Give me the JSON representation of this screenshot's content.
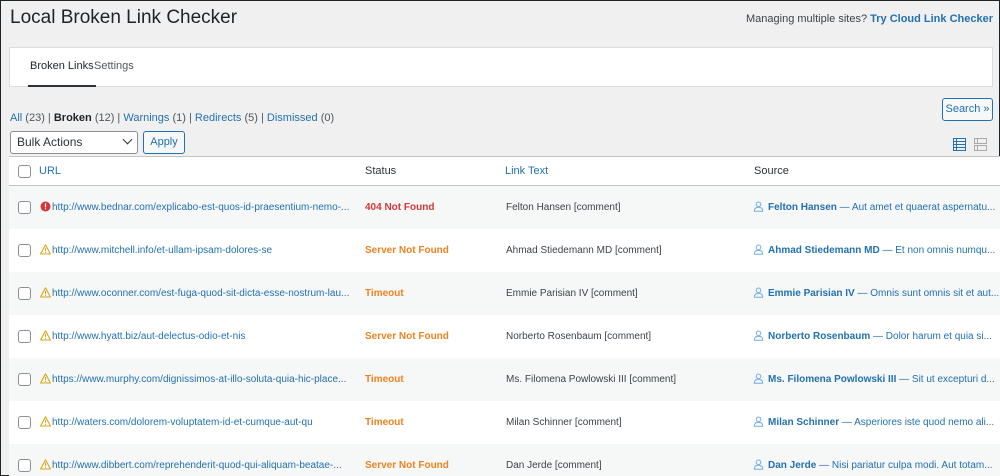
{
  "app": {
    "title": "Local Broken Link Checker",
    "promo_text": "Managing multiple sites? ",
    "promo_link": "Try Cloud Link Checker"
  },
  "tabs": [
    {
      "label": "Broken Links",
      "active": true
    },
    {
      "label": "Settings",
      "active": false
    }
  ],
  "filters": [
    {
      "label": "All",
      "count": "(23)",
      "current": false
    },
    {
      "label": "Broken",
      "count": "(12)",
      "current": true
    },
    {
      "label": "Warnings",
      "count": "(1)",
      "current": false
    },
    {
      "label": "Redirects",
      "count": "(5)",
      "current": false
    },
    {
      "label": "Dismissed",
      "count": "(0)",
      "current": false
    }
  ],
  "search_button": "Search »",
  "bulk": {
    "selected": "Bulk Actions",
    "apply_label": "Apply"
  },
  "columns": {
    "url": "URL",
    "status": "Status",
    "link_text": "Link Text",
    "source": "Source"
  },
  "colors": {
    "accent": "#2271b1",
    "error": "#d63638",
    "warning": "#f0821e",
    "warning_icon": "#dba617"
  },
  "rows": [
    {
      "icon": "error-icon",
      "url": "http://www.bednar.com/explicabo-est-quos-id-praesentium-nemo-...",
      "status": "404 Not Found",
      "status_type": "error",
      "link_text": "Felton Hansen [comment]",
      "source_author": "Felton Hansen",
      "source_excerpt": " — Aut amet et quaerat aspernatu..."
    },
    {
      "icon": "warning-icon",
      "url": "http://www.mitchell.info/et-ullam-ipsam-dolores-se",
      "status": "Server Not Found",
      "status_type": "warning",
      "link_text": "Ahmad Stiedemann MD [comment]",
      "source_author": "Ahmad Stiedemann MD",
      "source_excerpt": " — Et non omnis numqu..."
    },
    {
      "icon": "warning-icon",
      "url": "http://www.oconner.com/est-fuga-quod-sit-dicta-esse-nostrum-lau...",
      "status": "Timeout",
      "status_type": "warning",
      "link_text": "Emmie Parisian IV [comment]",
      "source_author": "Emmie Parisian IV",
      "source_excerpt": " — Omnis sunt omnis sit et aut..."
    },
    {
      "icon": "warning-icon",
      "url": "http://www.hyatt.biz/aut-delectus-odio-et-nis",
      "status": "Server Not Found",
      "status_type": "warning",
      "link_text": "Norberto Rosenbaum [comment]",
      "source_author": "Norberto Rosenbaum",
      "source_excerpt": " — Dolor harum et quia si..."
    },
    {
      "icon": "warning-icon",
      "url": "https://www.murphy.com/dignissimos-at-illo-soluta-quia-hic-place...",
      "status": "Timeout",
      "status_type": "warning",
      "link_text": "Ms. Filomena Powlowski III [comment]",
      "source_author": "Ms. Filomena Powlowski III",
      "source_excerpt": " — Sit ut excepturi d..."
    },
    {
      "icon": "warning-icon",
      "url": "http://waters.com/dolorem-voluptatem-id-et-cumque-aut-qu",
      "status": "Timeout",
      "status_type": "warning",
      "link_text": "Milan Schinner [comment]",
      "source_author": "Milan Schinner",
      "source_excerpt": " — Asperiores iste quod nemo ali..."
    },
    {
      "icon": "warning-icon",
      "url": "http://www.dibbert.com/reprehenderit-quod-qui-aliquam-beatae-...",
      "status": "Server Not Found",
      "status_type": "warning",
      "link_text": "Dan Jerde [comment]",
      "source_author": "Dan Jerde",
      "source_excerpt": " — Nisi pariatur culpa modi. Aut totam..."
    }
  ]
}
